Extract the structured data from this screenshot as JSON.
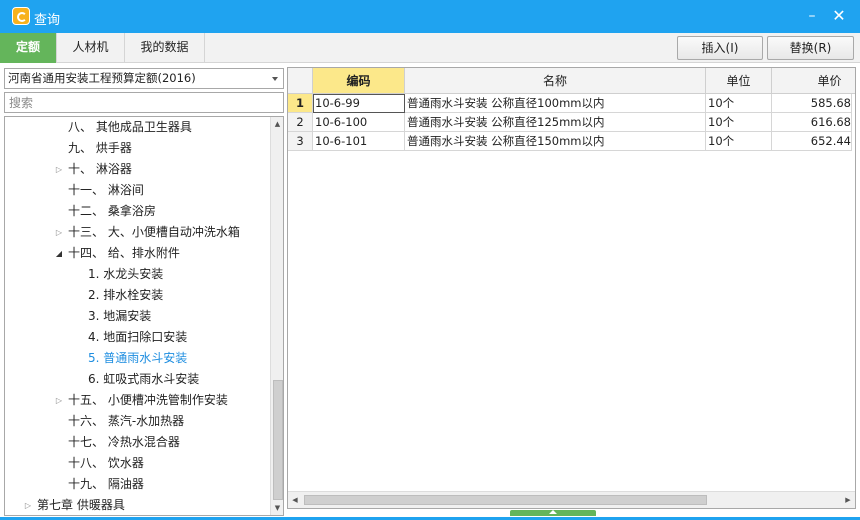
{
  "window": {
    "title": "查询",
    "minimize_symbol": "–",
    "close_symbol": "✕"
  },
  "tabs": [
    {
      "label": "定额",
      "active": true
    },
    {
      "label": "人材机",
      "active": false
    },
    {
      "label": "我的数据",
      "active": false
    }
  ],
  "toolbar": {
    "insert_label": "插入(I)",
    "replace_label": "替换(R)"
  },
  "left": {
    "quota_book": "河南省通用安装工程预算定额(2016)",
    "search_placeholder": "搜索",
    "tree": [
      {
        "label": "八、 其他成品卫生器具",
        "level": 1,
        "expander": ""
      },
      {
        "label": "九、 烘手器",
        "level": 1,
        "expander": ""
      },
      {
        "label": "十、 淋浴器",
        "level": 1,
        "expander": "▷"
      },
      {
        "label": "十一、 淋浴间",
        "level": 1,
        "expander": ""
      },
      {
        "label": "十二、 桑拿浴房",
        "level": 1,
        "expander": ""
      },
      {
        "label": "十三、 大、小便槽自动冲洗水箱",
        "level": 1,
        "expander": "▷"
      },
      {
        "label": "十四、 给、排水附件",
        "level": 1,
        "expander": "◢"
      },
      {
        "label": "1. 水龙头安装",
        "level": 2,
        "expander": ""
      },
      {
        "label": "2. 排水栓安装",
        "level": 2,
        "expander": ""
      },
      {
        "label": "3. 地漏安装",
        "level": 2,
        "expander": ""
      },
      {
        "label": "4. 地面扫除口安装",
        "level": 2,
        "expander": ""
      },
      {
        "label": "5. 普通雨水斗安装",
        "level": 2,
        "expander": "",
        "selected": true
      },
      {
        "label": "6. 虹吸式雨水斗安装",
        "level": 2,
        "expander": ""
      },
      {
        "label": "十五、 小便槽冲洗管制作安装",
        "level": 1,
        "expander": "▷"
      },
      {
        "label": "十六、 蒸汽-水加热器",
        "level": 1,
        "expander": ""
      },
      {
        "label": "十七、 冷热水混合器",
        "level": 1,
        "expander": ""
      },
      {
        "label": "十八、 饮水器",
        "level": 1,
        "expander": ""
      },
      {
        "label": "十九、 隔油器",
        "level": 1,
        "expander": ""
      },
      {
        "label": "第七章 供暖器具",
        "level": 0,
        "expander": "▷"
      }
    ]
  },
  "grid": {
    "columns": {
      "code": "编码",
      "name": "名称",
      "unit": "单位",
      "price": "单价"
    },
    "rows": [
      {
        "no": "1",
        "code": "10-6-99",
        "name": "普通雨水斗安装 公称直径100mm以内",
        "unit": "10个",
        "price": "585.68",
        "active": true
      },
      {
        "no": "2",
        "code": "10-6-100",
        "name": "普通雨水斗安装 公称直径125mm以内",
        "unit": "10个",
        "price": "616.68",
        "active": false
      },
      {
        "no": "3",
        "code": "10-6-101",
        "name": "普通雨水斗安装 公称直径150mm以内",
        "unit": "10个",
        "price": "652.44",
        "active": false
      }
    ]
  }
}
